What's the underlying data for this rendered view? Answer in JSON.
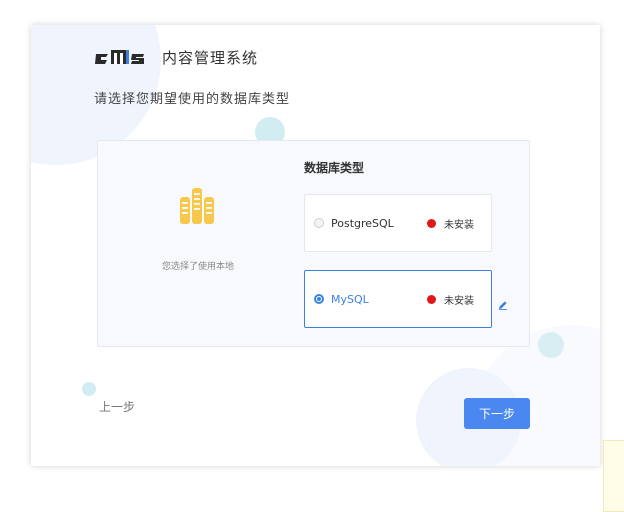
{
  "header": {
    "logo_text": "cms",
    "title": "内容管理系统"
  },
  "prompt": "请选择您期望使用的数据库类型",
  "panel": {
    "icon": "database-server-icon",
    "selected_text": "您选择了使用本地",
    "section_title": "数据库类型",
    "options": [
      {
        "name": "PostgreSQL",
        "status": "未安装",
        "selected": false
      },
      {
        "name": "MySQL",
        "status": "未安装",
        "selected": true
      }
    ]
  },
  "footer": {
    "prev_label": "上一步",
    "next_label": "下一步"
  },
  "colors": {
    "accent": "#4a87ee",
    "selected_border": "#3b82e0",
    "status_dot": "#e01818",
    "db_icon": "#f7c84b"
  }
}
